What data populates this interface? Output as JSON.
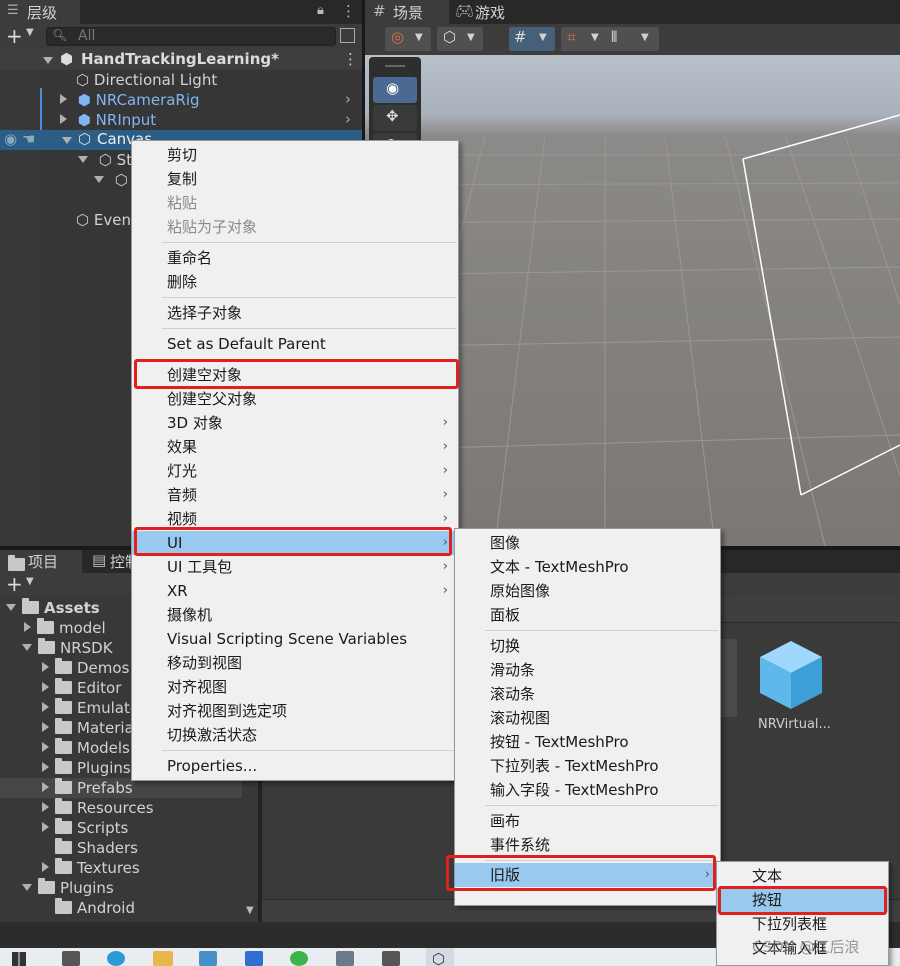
{
  "hierarchy": {
    "tab_label": "层级",
    "search_placeholder": "All",
    "scene_name": "HandTrackingLearning*",
    "items": [
      {
        "label": "Directional Light"
      },
      {
        "label": "NRCameraRig"
      },
      {
        "label": "NRInput"
      },
      {
        "label": "Canvas"
      },
      {
        "label": "St"
      },
      {
        "label": "Even"
      }
    ]
  },
  "scene_view": {
    "tab_scene": "场景",
    "tab_game": "游戏"
  },
  "project": {
    "tab_label": "项目",
    "tab_console": "控制",
    "tree": [
      {
        "label": "Assets"
      },
      {
        "label": "model"
      },
      {
        "label": "NRSDK"
      },
      {
        "label": "Demos"
      },
      {
        "label": "Editor"
      },
      {
        "label": "Emulato"
      },
      {
        "label": "Materia"
      },
      {
        "label": "Models"
      },
      {
        "label": "Plugins"
      },
      {
        "label": "Prefabs"
      },
      {
        "label": "Resources"
      },
      {
        "label": "Scripts"
      },
      {
        "label": "Shaders"
      },
      {
        "label": "Textures"
      },
      {
        "label": "Plugins"
      },
      {
        "label": "Android"
      }
    ],
    "asset_name": "NRVirtual..."
  },
  "context_menu": {
    "items": [
      {
        "label": "剪切"
      },
      {
        "label": "复制"
      },
      {
        "label": "粘贴"
      },
      {
        "label": "粘贴为子对象"
      },
      {
        "label": "重命名"
      },
      {
        "label": "删除"
      },
      {
        "label": "选择子对象"
      },
      {
        "label": "Set as Default Parent"
      },
      {
        "label": "创建空对象"
      },
      {
        "label": "创建空父对象"
      },
      {
        "label": "3D 对象"
      },
      {
        "label": "效果"
      },
      {
        "label": "灯光"
      },
      {
        "label": "音频"
      },
      {
        "label": "视频"
      },
      {
        "label": "UI"
      },
      {
        "label": "UI 工具包"
      },
      {
        "label": "XR"
      },
      {
        "label": "摄像机"
      },
      {
        "label": "Visual Scripting Scene Variables"
      },
      {
        "label": "移动到视图"
      },
      {
        "label": "对齐视图"
      },
      {
        "label": "对齐视图到选定项"
      },
      {
        "label": "切换激活状态"
      },
      {
        "label": "Properties..."
      }
    ]
  },
  "ui_submenu": {
    "items": [
      {
        "label": "图像"
      },
      {
        "label": "文本 - TextMeshPro"
      },
      {
        "label": "原始图像"
      },
      {
        "label": "面板"
      },
      {
        "label": "切换"
      },
      {
        "label": "滑动条"
      },
      {
        "label": "滚动条"
      },
      {
        "label": "滚动视图"
      },
      {
        "label": "按钮 - TextMeshPro"
      },
      {
        "label": "下拉列表 - TextMeshPro"
      },
      {
        "label": "输入字段 - TextMeshPro"
      },
      {
        "label": "画布"
      },
      {
        "label": "事件系统"
      },
      {
        "label": "旧版"
      }
    ]
  },
  "legacy_submenu": {
    "items": [
      {
        "label": "文本"
      },
      {
        "label": "按钮"
      },
      {
        "label": "下拉列表框"
      },
      {
        "label": "文本输入框"
      }
    ]
  },
  "watermark": "CSDN @江后浪",
  "colors": {
    "menu_highlight": "#99c9ef",
    "annotation_red": "#e0201c",
    "prefab_blue": "#7fb6f2"
  }
}
